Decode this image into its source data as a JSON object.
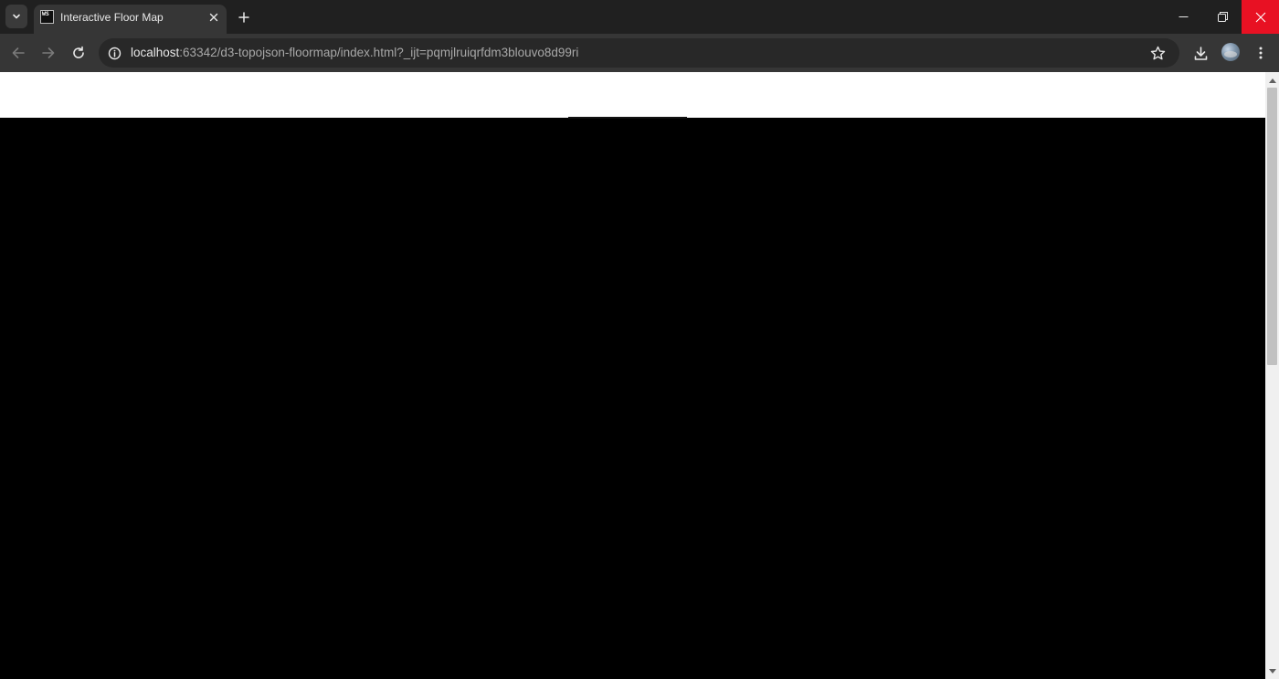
{
  "browser": {
    "tab": {
      "title": "Interactive Floor Map",
      "favicon_text": "WS"
    },
    "address_bar": {
      "host": "localhost",
      "path": ":63342/d3-topojson-floormap/index.html?_ijt=pqmjlruiqrfdm3blouvo8d99ri"
    },
    "colors": {
      "titlebar": "#202020",
      "toolbar": "#363636",
      "omnibox": "#282828",
      "close_hover": "#e81123",
      "page_header": "#ffffff",
      "canvas": "#000000"
    },
    "icons": [
      "chevron-down-icon",
      "close-icon",
      "plus-icon",
      "minimize-icon",
      "restore-icon",
      "back-arrow-icon",
      "forward-arrow-icon",
      "reload-icon",
      "info-icon",
      "star-icon",
      "download-icon",
      "kebab-menu-icon"
    ]
  }
}
